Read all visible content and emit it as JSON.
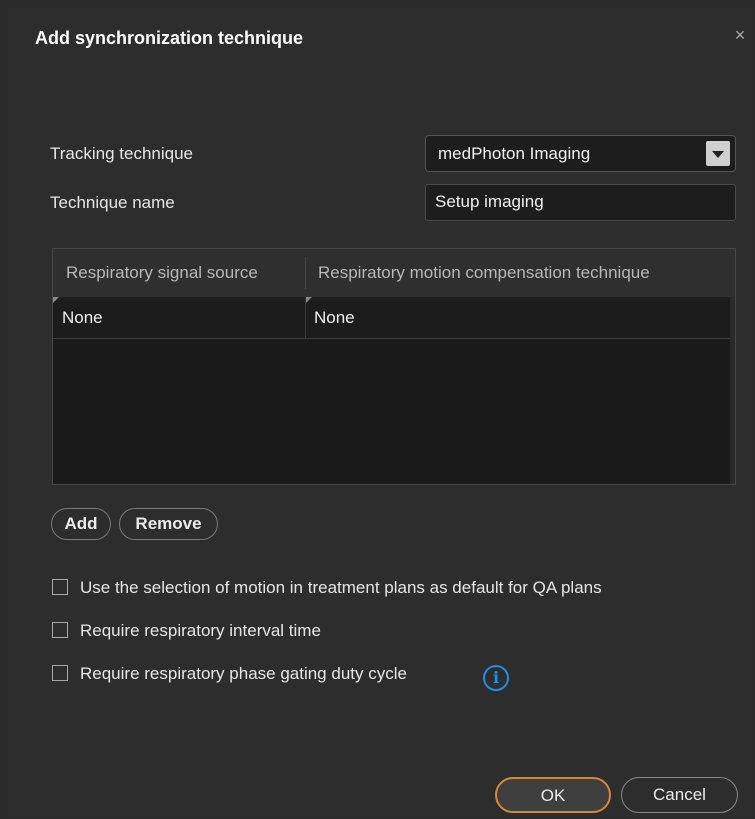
{
  "dialog": {
    "title": "Add synchronization technique",
    "close_symbol": "×"
  },
  "form": {
    "tracking_label": "Tracking technique",
    "tracking_value": "medPhoton Imaging",
    "name_label": "Technique name",
    "name_value": "Setup imaging"
  },
  "table": {
    "columns": [
      "Respiratory signal source",
      "Respiratory motion compensation technique"
    ],
    "rows": [
      [
        "None",
        "None"
      ]
    ]
  },
  "buttons": {
    "add": "Add",
    "remove": "Remove",
    "ok": "OK",
    "cancel": "Cancel"
  },
  "options": [
    {
      "label": "Use the selection of motion in treatment plans as default for QA plans",
      "checked": false
    },
    {
      "label": "Require respiratory interval time",
      "checked": false
    },
    {
      "label": "Require respiratory phase gating duty cycle",
      "checked": false
    }
  ],
  "icons": {
    "info": "info-icon",
    "info_glyph": "i"
  },
  "colors": {
    "accent_ok_border": "#d7873a",
    "info_blue": "#1f8ee8",
    "background": "#2d2d2d"
  }
}
